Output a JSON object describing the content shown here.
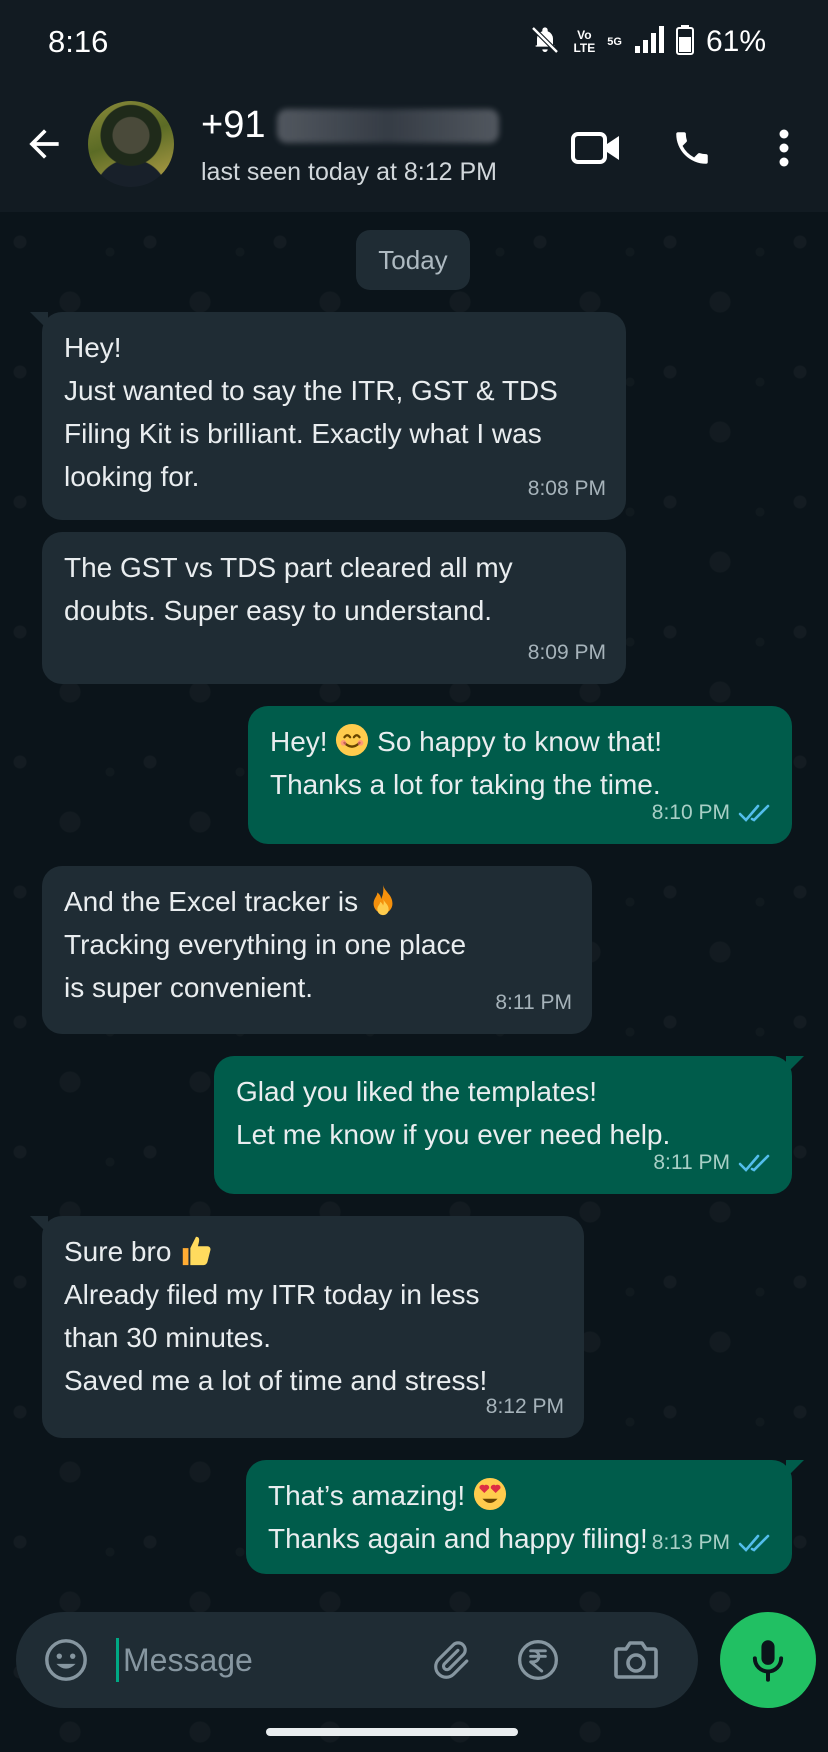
{
  "status_bar": {
    "time": "8:16",
    "network_label_top": "Vo",
    "network_label_bottom": "LTE",
    "network_gen": "5G",
    "battery": "61%"
  },
  "header": {
    "contact_prefix": "+91",
    "last_seen": "last seen today at 8:12 PM"
  },
  "date_chip": "Today",
  "messages": [
    {
      "direction": "in",
      "lines": [
        "Hey!",
        "Just wanted to say the ITR, GST & TDS",
        "Filing Kit is brilliant. Exactly what I was",
        "looking for."
      ],
      "time": "8:08 PM"
    },
    {
      "direction": "in",
      "lines": [
        "The GST vs TDS part cleared all my",
        "doubts. Super easy to understand."
      ],
      "time": "8:09 PM"
    },
    {
      "direction": "out",
      "lines": [
        "Hey!",
        "So happy to know that!",
        "Thanks a lot for taking the time."
      ],
      "emoji": "smiling-face-emoji",
      "time": "8:10 PM",
      "status": "read"
    },
    {
      "direction": "in",
      "lines": [
        "And the Excel tracker is",
        "Tracking everything in one place",
        "is super convenient."
      ],
      "emoji": "fire-emoji",
      "time": "8:11 PM"
    },
    {
      "direction": "out",
      "lines": [
        "Glad you liked the templates!",
        "Let me know if you ever need help."
      ],
      "time": "8:11 PM",
      "status": "read"
    },
    {
      "direction": "in",
      "lines": [
        "Sure bro",
        "Already filed my ITR today in less",
        "than 30 minutes.",
        "Saved me a lot of time and stress!"
      ],
      "emoji": "thumbs-up-emoji",
      "time": "8:12 PM"
    },
    {
      "direction": "out",
      "lines": [
        "That’s amazing!",
        "Thanks again and happy filing!"
      ],
      "emoji": "heart-eyes-emoji",
      "time": "8:13 PM",
      "status": "read"
    }
  ],
  "composer": {
    "placeholder": "Message"
  },
  "colors": {
    "background": "#0b141a",
    "incoming_bubble": "#1f2c34",
    "outgoing_bubble": "#005c4b",
    "read_ticks": "#53bdeb",
    "mic_button": "#21c063"
  }
}
